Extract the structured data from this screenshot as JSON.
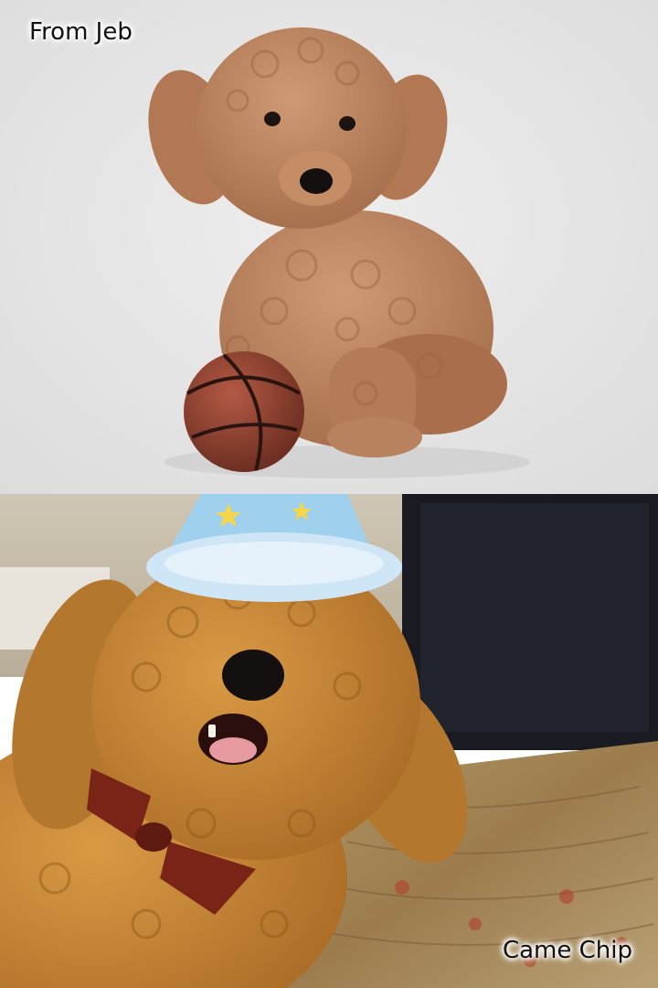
{
  "captions": {
    "top": "From Jeb",
    "bottom": "Came Chip"
  },
  "colors": {
    "studio_background": "#e6e6e6",
    "puppy_fur": "#b9825e",
    "basketball": "#8a3f2e",
    "adult_fur": "#c98836",
    "party_hat": "#9fd0ee",
    "bow_tie": "#7a2418",
    "rug": "#a8895a"
  },
  "icons": {
    "top_photo": "puppy-with-basketball-photo",
    "bottom_photo": "dog-in-party-hat-photo"
  }
}
